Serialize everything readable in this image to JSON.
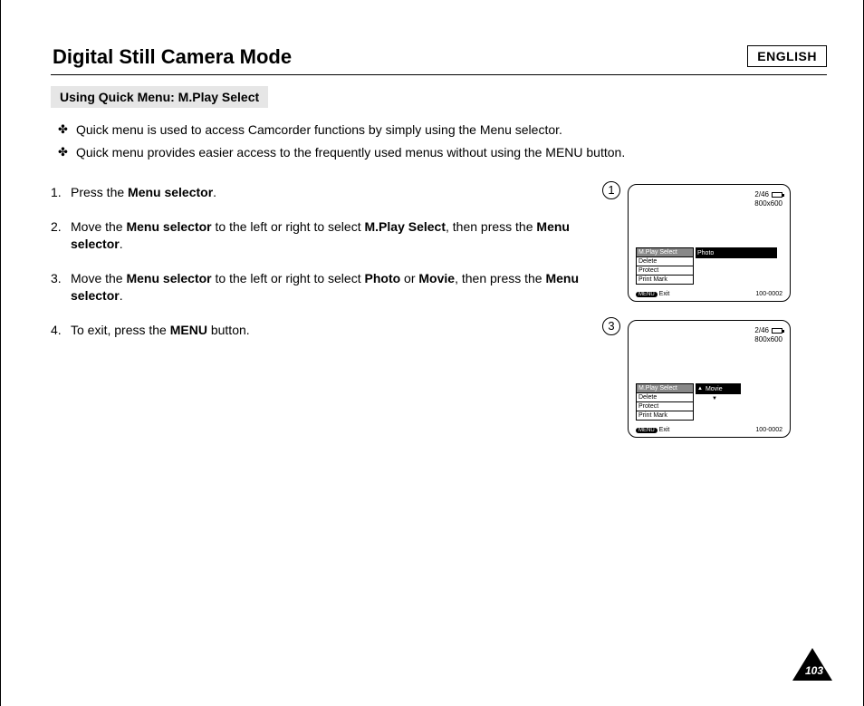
{
  "lang": "ENGLISH",
  "title": "Digital Still Camera Mode",
  "subtitle": "Using Quick Menu: M.Play Select",
  "intro": {
    "i1": "Quick menu is used to access Camcorder functions by simply using the Menu selector.",
    "i2": "Quick menu provides easier access to the frequently used menus without using the MENU button."
  },
  "steps": {
    "s1a": "Press the ",
    "s1b": "Menu selector",
    "s1c": ".",
    "s2a": "Move the ",
    "s2b": "Menu selector",
    "s2c": " to the left or right to select ",
    "s2d": "M.Play Select",
    "s2e": ", then press the ",
    "s2f": "Menu selector",
    "s2g": ".",
    "s3a": "Move the ",
    "s3b": "Menu selector",
    "s3c": " to the left or right to select ",
    "s3d": "Photo",
    "s3e": " or ",
    "s3f": "Movie",
    "s3g": ", then press the ",
    "s3h": "Menu selector",
    "s3i": ".",
    "s4a": "To exit, press the ",
    "s4b": "MENU",
    "s4c": " button."
  },
  "lcd": {
    "counter": "2/46",
    "res": "800x600",
    "menu": {
      "m1": "M.Play Select",
      "m2": "Delete",
      "m3": "Protect",
      "m4": "Print Mark"
    },
    "val1": "Photo",
    "val2": "Movie",
    "menu_btn": "MENU",
    "exit": "Exit",
    "filenum": "100-0002"
  },
  "dia": {
    "n1": "1",
    "n2": "3"
  },
  "page": "103"
}
